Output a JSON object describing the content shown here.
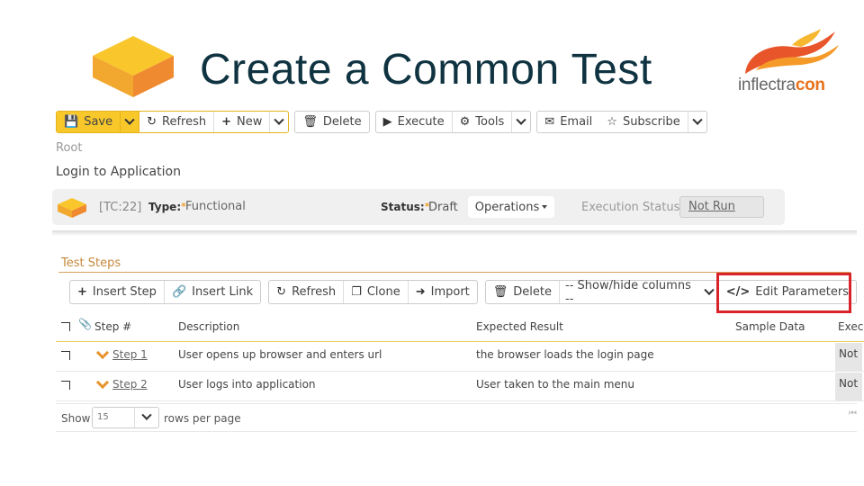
{
  "slide": {
    "title": "Create a Common Test",
    "brand": {
      "light": "inflectra",
      "bold": "con"
    }
  },
  "toolbar": {
    "save": "Save",
    "refresh": "Refresh",
    "new": "New",
    "delete": "Delete",
    "execute": "Execute",
    "tools": "Tools",
    "email": "Email",
    "subscribe": "Subscribe"
  },
  "breadcrumb": "Root",
  "artifact": {
    "name": "Login to Application",
    "id": "[TC:22]",
    "type_label": "Type:",
    "type_value": "Functional",
    "status_label": "Status:",
    "status_value": "Draft",
    "workflow_button": "Operations",
    "execution_status_label": "Execution Status:",
    "execution_status_value": "Not Run"
  },
  "test_steps": {
    "section_title": "Test Steps",
    "toolbar": {
      "insert_step": "Insert Step",
      "insert_link": "Insert Link",
      "refresh": "Refresh",
      "clone": "Clone",
      "import": "Import",
      "delete": "Delete",
      "show_hide_columns": "-- Show/hide columns --",
      "edit_parameters": "Edit Parameters"
    },
    "columns": [
      "Step #",
      "Description",
      "Expected Result",
      "Sample Data",
      "Exec"
    ],
    "rows": [
      {
        "step": "Step 1",
        "description": "User opens up browser and enters url",
        "expected": "the browser loads the login page",
        "sample": "",
        "exec": "Not"
      },
      {
        "step": "Step 2",
        "description": "User logs into application",
        "expected": "User taken to the main menu",
        "sample": "",
        "exec": "Not"
      }
    ],
    "pagination": {
      "show_label": "Show",
      "rows_per_page": "15",
      "rows_label": "rows per page"
    }
  },
  "colors": {
    "accent": "#f8c82b",
    "highlight": "#d8232a",
    "title": "#0f3340",
    "section": "#c6883c"
  }
}
